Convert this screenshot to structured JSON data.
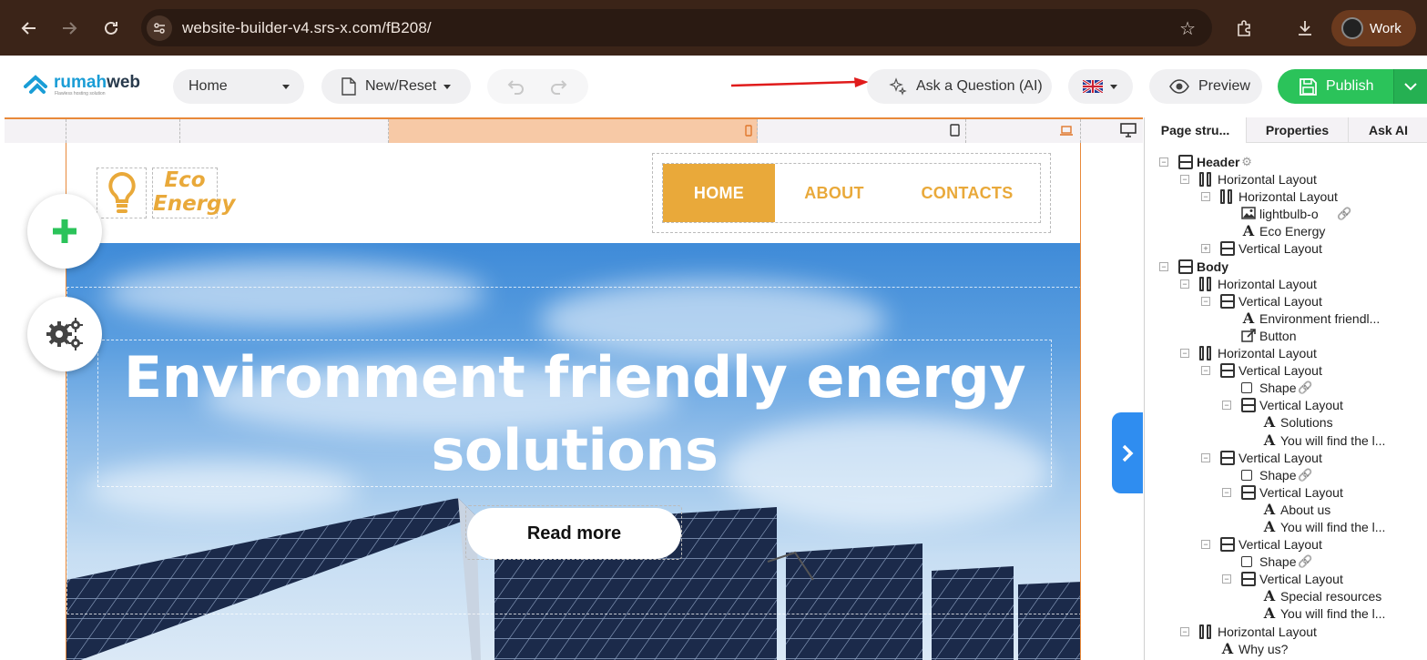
{
  "browser": {
    "url": "website-builder-v4.srs-x.com/fB208/",
    "profile_label": "Work"
  },
  "toolbar": {
    "logo_text_a": "rumah",
    "logo_text_b": "web",
    "logo_subtext": "Flawless hosting solution",
    "page_select": "Home",
    "new_reset": "New/Reset",
    "ask_ai": "Ask a Question (AI)",
    "preview": "Preview",
    "publish": "Publish",
    "accent_green": "#2bc35a"
  },
  "site": {
    "brand_line1": "Eco",
    "brand_line2": "Energy",
    "menu": [
      "HOME",
      "ABOUT",
      "CONTACTS"
    ],
    "hero_title": "Environment friendly energy solutions",
    "hero_button": "Read more",
    "accent": "#e9a93a"
  },
  "panel": {
    "tabs": [
      "Page stru...",
      "Properties",
      "Ask AI"
    ],
    "tree": [
      {
        "label": "Header",
        "icon": "vertical-layout-icon",
        "depth": 0,
        "bold": true,
        "toggle": "minus",
        "link": "components-icon"
      },
      {
        "label": "Horizontal Layout",
        "icon": "horizontal-layout-icon",
        "depth": 1,
        "toggle": "minus"
      },
      {
        "label": "Horizontal Layout",
        "icon": "horizontal-layout-icon",
        "depth": 2,
        "toggle": "minus"
      },
      {
        "label": "lightbulb-o",
        "icon": "image-icon",
        "depth": 3,
        "link": "link-icon"
      },
      {
        "label": "Eco Energy",
        "icon": "text-icon",
        "depth": 3
      },
      {
        "label": "Vertical Layout",
        "icon": "vertical-layout-icon",
        "depth": 2,
        "toggle": "plus"
      },
      {
        "label": "Body",
        "icon": "vertical-layout-icon",
        "depth": 0,
        "bold": true,
        "toggle": "minus"
      },
      {
        "label": "Horizontal Layout",
        "icon": "horizontal-layout-icon",
        "depth": 1,
        "toggle": "minus"
      },
      {
        "label": "Vertical Layout",
        "icon": "vertical-layout-icon",
        "depth": 2,
        "toggle": "minus"
      },
      {
        "label": "Environment friendl...",
        "icon": "text-icon",
        "depth": 3
      },
      {
        "label": "Button",
        "icon": "button-icon",
        "depth": 3
      },
      {
        "label": "Horizontal Layout",
        "icon": "horizontal-layout-icon",
        "depth": 1,
        "toggle": "minus"
      },
      {
        "label": "Vertical Layout",
        "icon": "vertical-layout-icon",
        "depth": 2,
        "toggle": "minus"
      },
      {
        "label": "Shape",
        "icon": "shape-icon",
        "depth": 3,
        "link": "link-icon"
      },
      {
        "label": "Vertical Layout",
        "icon": "vertical-layout-icon",
        "depth": 3,
        "toggle": "minus"
      },
      {
        "label": "Solutions",
        "icon": "text-icon",
        "depth": 4
      },
      {
        "label": "You will find the l...",
        "icon": "text-icon",
        "depth": 4
      },
      {
        "label": "Vertical Layout",
        "icon": "vertical-layout-icon",
        "depth": 2,
        "toggle": "minus"
      },
      {
        "label": "Shape",
        "icon": "shape-icon",
        "depth": 3,
        "link": "link-icon"
      },
      {
        "label": "Vertical Layout",
        "icon": "vertical-layout-icon",
        "depth": 3,
        "toggle": "minus"
      },
      {
        "label": "About us",
        "icon": "text-icon",
        "depth": 4
      },
      {
        "label": "You will find the l...",
        "icon": "text-icon",
        "depth": 4
      },
      {
        "label": "Vertical Layout",
        "icon": "vertical-layout-icon",
        "depth": 2,
        "toggle": "minus"
      },
      {
        "label": "Shape",
        "icon": "shape-icon",
        "depth": 3,
        "link": "link-icon"
      },
      {
        "label": "Vertical Layout",
        "icon": "vertical-layout-icon",
        "depth": 3,
        "toggle": "minus"
      },
      {
        "label": "Special resources",
        "icon": "text-icon",
        "depth": 4
      },
      {
        "label": "You will find the l...",
        "icon": "text-icon",
        "depth": 4
      },
      {
        "label": "Horizontal Layout",
        "icon": "horizontal-layout-icon",
        "depth": 1,
        "toggle": "minus"
      },
      {
        "label": "Why us?",
        "icon": "text-icon",
        "depth": 2
      }
    ]
  }
}
